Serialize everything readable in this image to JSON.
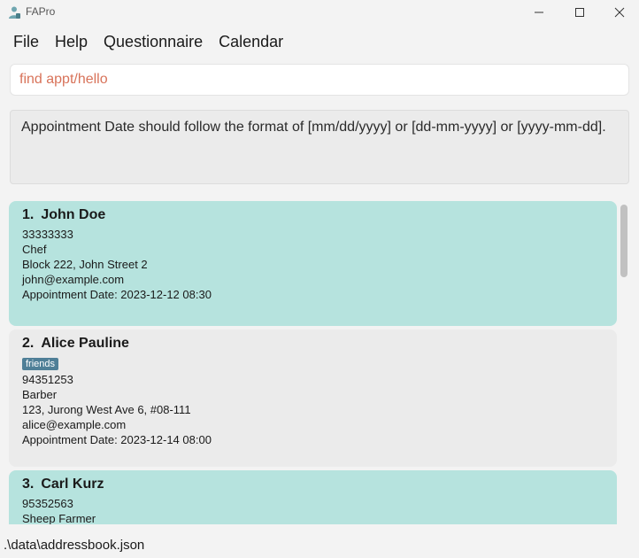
{
  "window": {
    "title": "FAPro",
    "app_icon": "person-icon"
  },
  "menu": {
    "items": [
      "File",
      "Help",
      "Questionnaire",
      "Calendar"
    ]
  },
  "command": {
    "value": "find appt/hello",
    "placeholder": ""
  },
  "result": {
    "message": "Appointment Date should follow the format of [mm/dd/yyyy] or [dd-mm-yyyy] or [yyyy-mm-dd]."
  },
  "persons": [
    {
      "index": "1.",
      "name": "John Doe",
      "tags": [],
      "phone": "33333333",
      "occupation": "Chef",
      "address": "Block 222, John Street 2",
      "email": "john@example.com",
      "appointment": "Appointment Date: 2023-12-12 08:30"
    },
    {
      "index": "2.",
      "name": "Alice Pauline",
      "tags": [
        "friends"
      ],
      "phone": "94351253",
      "occupation": "Barber",
      "address": "123, Jurong West Ave 6, #08-111",
      "email": "alice@example.com",
      "appointment": "Appointment Date: 2023-12-14 08:00"
    },
    {
      "index": "3.",
      "name": "Carl Kurz",
      "tags": [],
      "phone": "95352563",
      "occupation": "Sheep Farmer"
    }
  ],
  "status": {
    "file_path": ".\\data\\addressbook.json"
  },
  "colors": {
    "card_highlight": "#b6e3de",
    "card_default": "#ebebeb",
    "tag": "#4f7f97",
    "command_text": "#d8735a"
  }
}
